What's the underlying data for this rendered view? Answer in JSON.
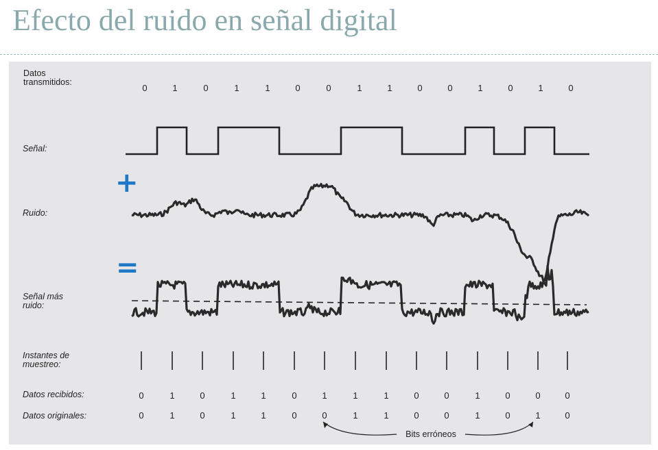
{
  "title": "Efecto del ruido en señal digital",
  "labels": {
    "transmitted": "Datos\ntransmitidos:",
    "signal": "Señal:",
    "noise": "Ruido:",
    "signal_plus_noise": "Señal más\nruido:",
    "sampling": "Instantes de\nmuestreo:",
    "received": "Datos recibidos:",
    "original": "Datos originales:",
    "bit_errors": "Bits erróneos"
  },
  "symbols": {
    "plus": "+",
    "equals": "="
  },
  "colors": {
    "title": "#8aa9ad",
    "accent": "#1f78c8"
  },
  "bits": {
    "transmitted": [
      "0",
      "1",
      "0",
      "1",
      "1",
      "0",
      "0",
      "1",
      "1",
      "0",
      "0",
      "1",
      "0",
      "1",
      "0"
    ],
    "received": [
      "0",
      "1",
      "0",
      "1",
      "1",
      "0",
      "1",
      "1",
      "1",
      "0",
      "0",
      "1",
      "0",
      "0",
      "0"
    ],
    "original": [
      "0",
      "1",
      "0",
      "1",
      "1",
      "0",
      "0",
      "1",
      "1",
      "0",
      "0",
      "1",
      "0",
      "1",
      "0"
    ]
  }
}
